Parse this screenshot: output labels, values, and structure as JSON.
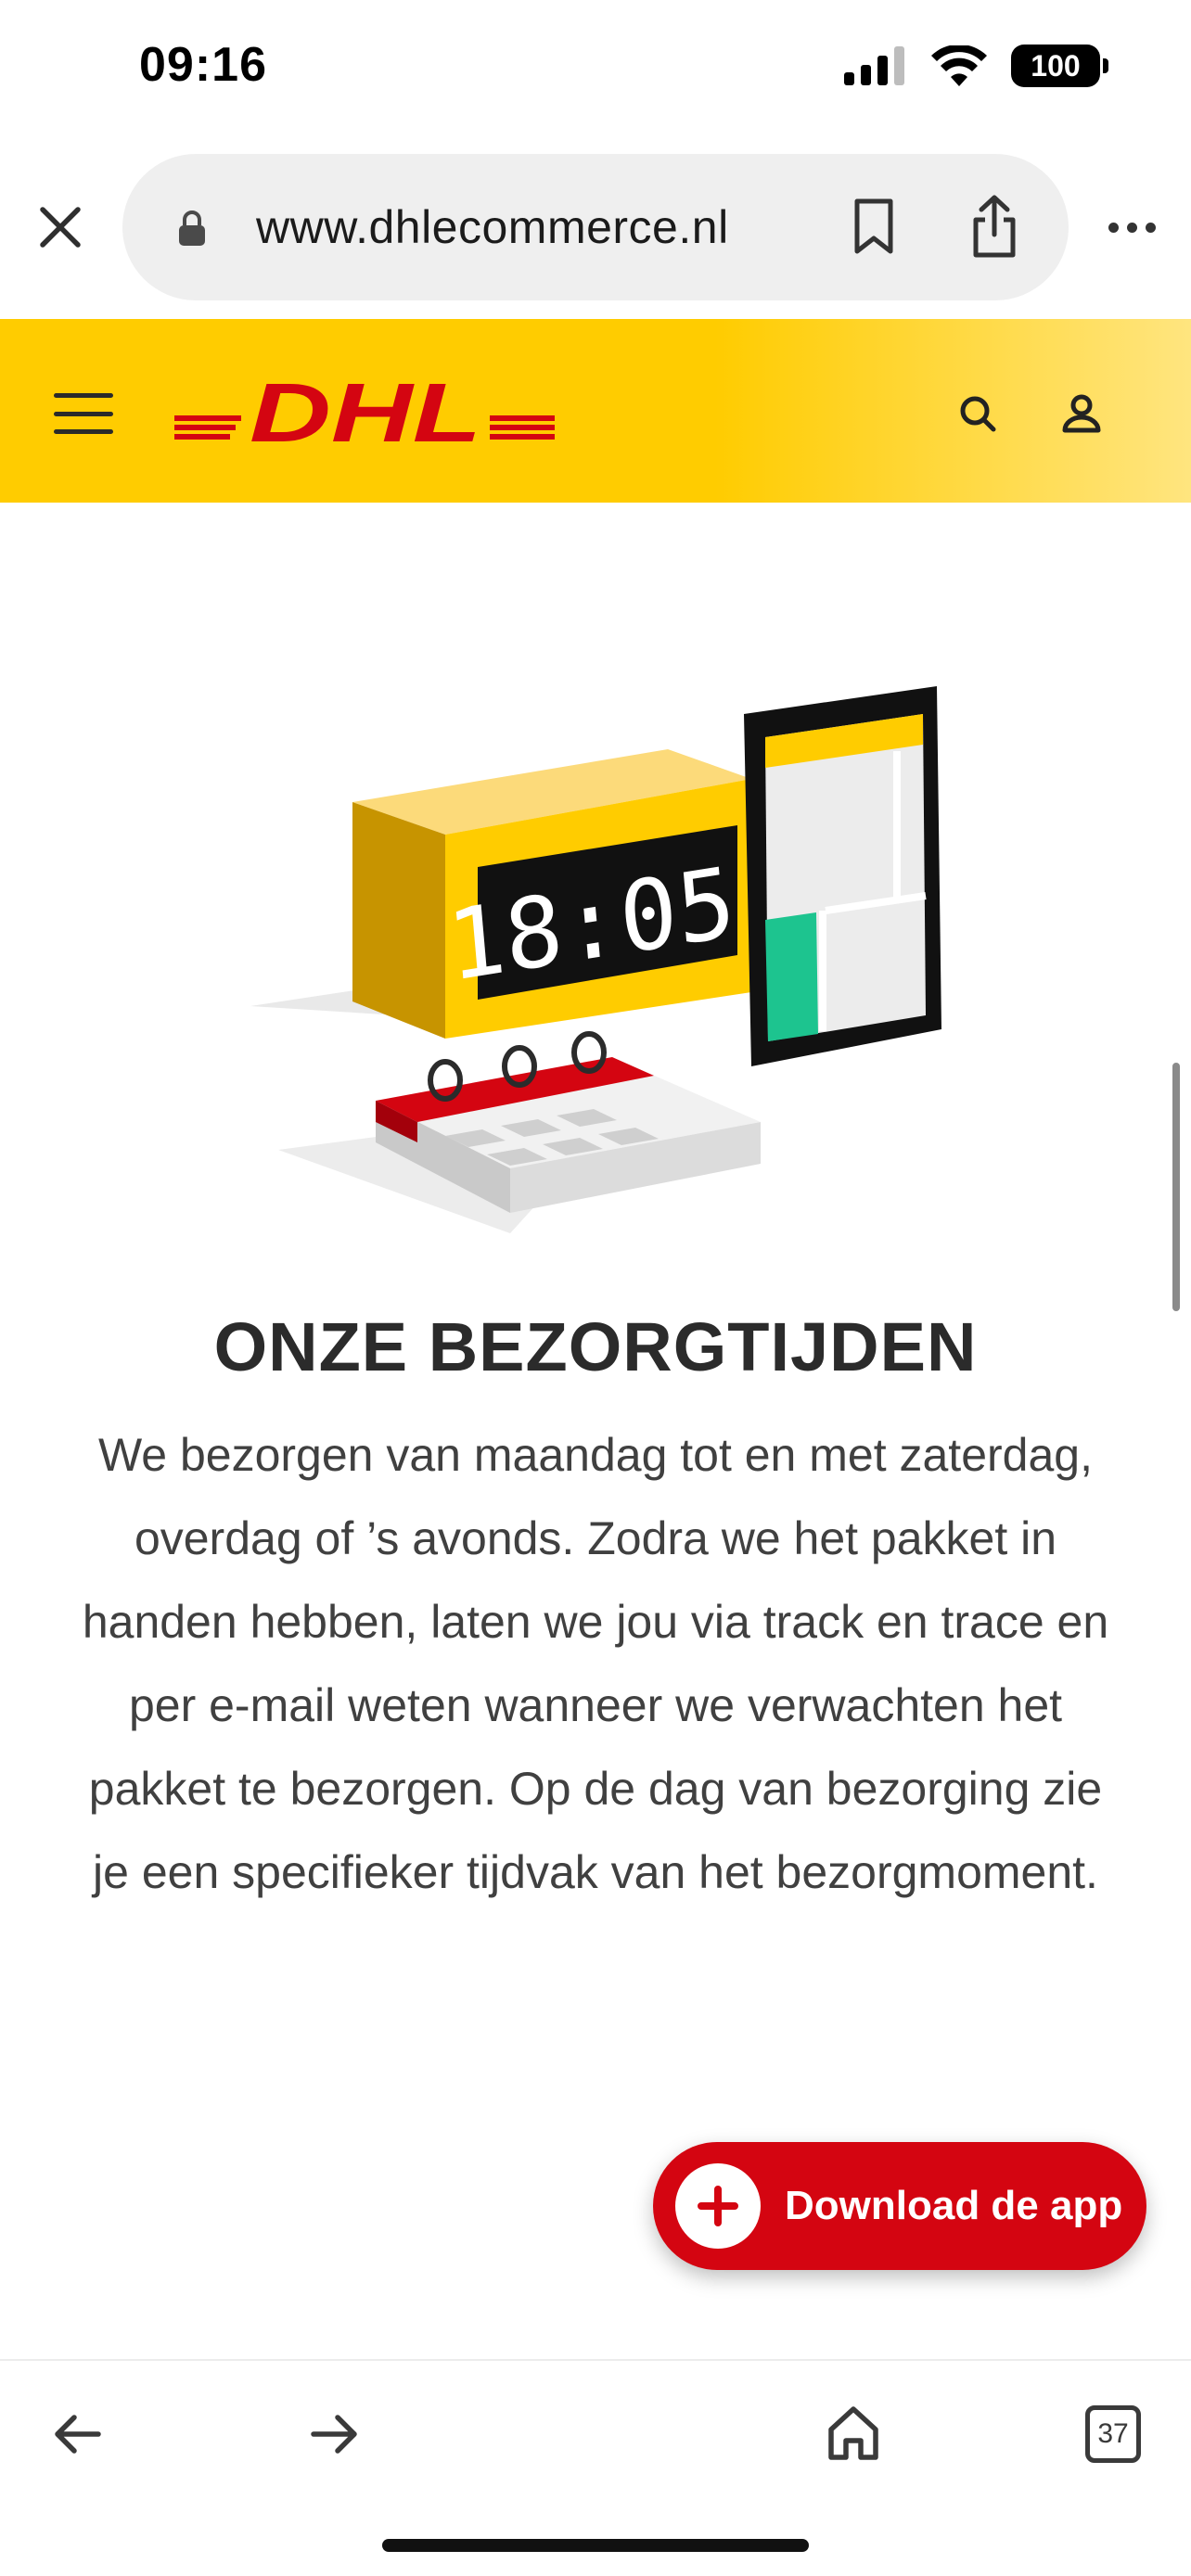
{
  "status_bar": {
    "time": "09:16",
    "battery": "100",
    "icons": [
      "signal-icon",
      "wifi-icon",
      "battery-icon"
    ]
  },
  "browser": {
    "url": "www.dhlecommerce.nl",
    "close_icon": "close-icon",
    "lock_icon": "lock-icon",
    "bookmark_icon": "bookmark-icon",
    "share_icon": "share-icon",
    "more_icon": "more-icon"
  },
  "site_header": {
    "brand": "DHL",
    "brand_color": "#d40511",
    "background_color": "#ffcc00",
    "menu_icon": "hamburger-icon",
    "search_icon": "search-icon",
    "account_icon": "user-icon"
  },
  "illustration": {
    "clock_display": "18:05"
  },
  "content": {
    "title": "ONZE BEZORGTIJDEN",
    "body": "We bezorgen van maandag tot en met zaterdag, overdag of ’s avonds. Zodra we het pakket in handen hebben, laten we jou via track en trace en per e-mail weten wanneer we verwachten het pakket te bezorgen. Op de dag van bezorging zie je een specifieker tijdvak van het bezorgmoment."
  },
  "floating_button": {
    "label": "Download de app",
    "icon": "plus-icon",
    "color": "#d40511"
  },
  "bottom_toolbar": {
    "back_icon": "arrow-left-icon",
    "forward_icon": "arrow-right-icon",
    "home_icon": "home-icon",
    "tab_count": "37"
  }
}
